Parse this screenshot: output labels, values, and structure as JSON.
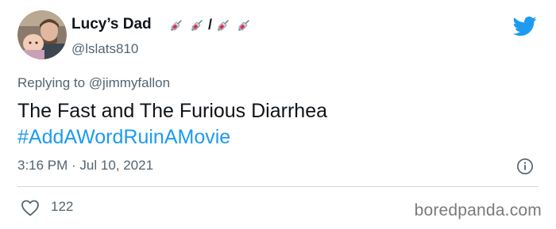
{
  "tweet": {
    "author": {
      "display_name": "Lucy’s Dad",
      "handle": "@lslats810",
      "name_emojis": [
        "syringe-icon",
        "syringe-icon",
        "syringe-icon",
        "syringe-icon"
      ],
      "name_separator": "/"
    },
    "reply": {
      "prefix": "Replying to",
      "mention": "@jimmyfallon"
    },
    "text": "The Fast and The Furious Diarrhea",
    "hashtag": "#AddAWordRuinAMovie",
    "timestamp": "3:16 PM · Jul 10, 2021",
    "likes": "122"
  },
  "watermark": "boredpanda.com",
  "colors": {
    "link": "#1d9bf0",
    "secondary_text": "#536471",
    "primary_text": "#0f1419",
    "twitter_brand": "#1d9bf0"
  }
}
